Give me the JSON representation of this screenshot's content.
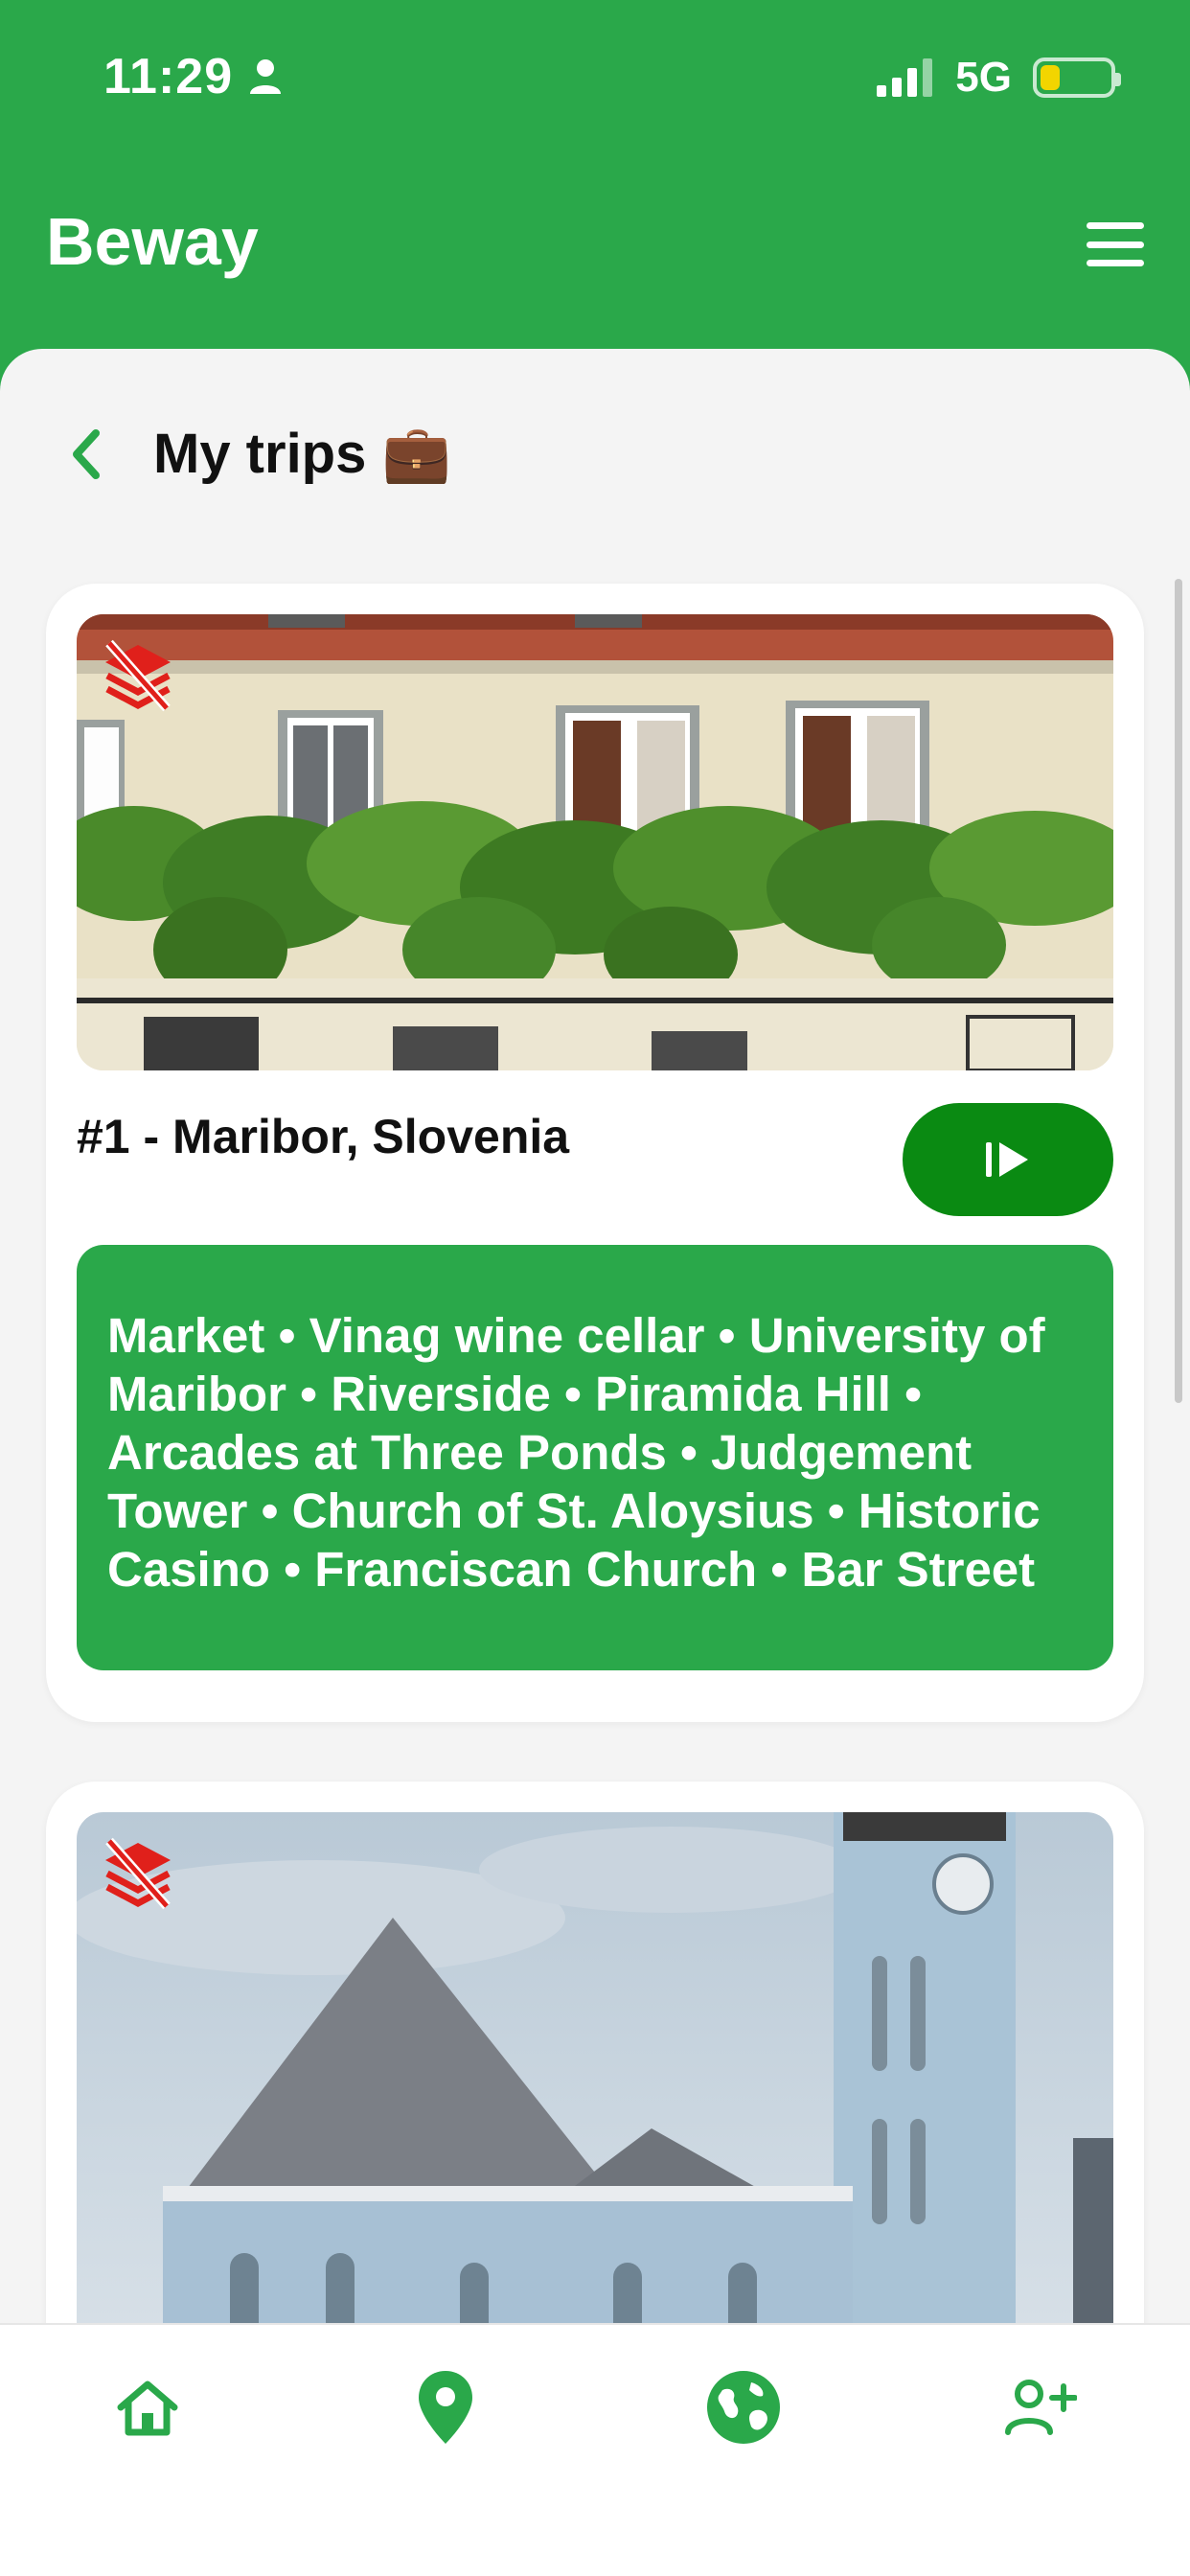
{
  "status_bar": {
    "time": "11:29",
    "network": "5G"
  },
  "header": {
    "app_title": "Beway",
    "menu_icon": "hamburger-menu-icon"
  },
  "page": {
    "title": "My trips 💼",
    "back_icon": "chevron-left-icon"
  },
  "trips": [
    {
      "name": "#1 - Maribor, Slovenia",
      "places": "Market • Vinag wine cellar • University of Maribor • Riverside • Piramida Hill • Arcades at Three Ponds • Judgement Tower • Church of St. Aloysius • Historic Casino • Franciscan Church • Bar Street",
      "start_icon": "start-trip-icon",
      "layers_icon": "layers-off-icon"
    },
    {
      "layers_icon": "layers-off-icon"
    }
  ],
  "bottom_nav": [
    {
      "icon": "home-icon"
    },
    {
      "icon": "map-pin-icon"
    },
    {
      "icon": "globe-icon"
    },
    {
      "icon": "add-user-icon"
    }
  ],
  "colors": {
    "brand_green": "#2aa84a",
    "button_green": "#0a8a12",
    "layers_icon_red": "#e0201b",
    "background": "#f4f4f4"
  }
}
